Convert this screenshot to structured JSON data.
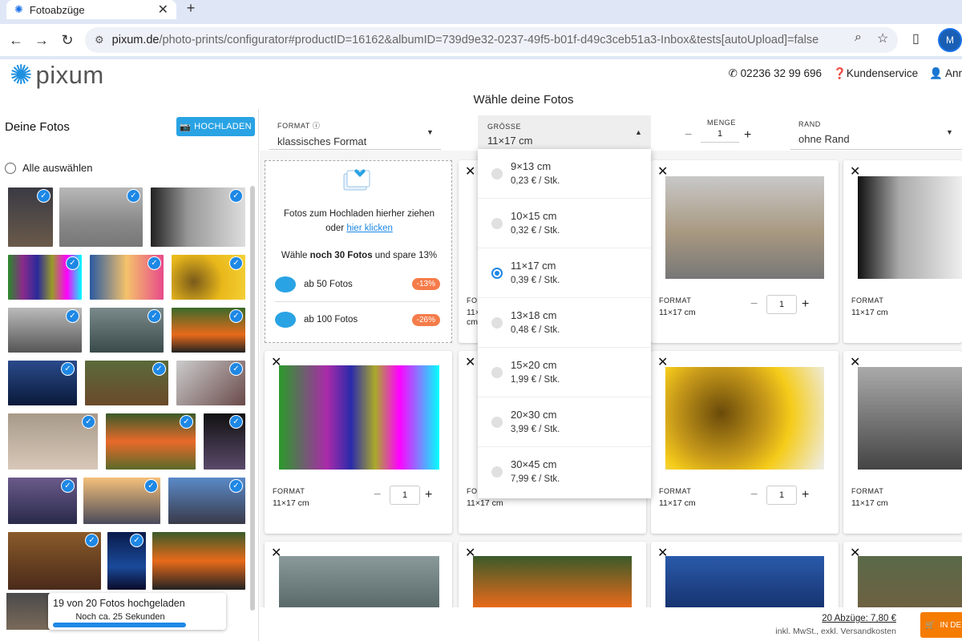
{
  "browser": {
    "tab_title": "Fotoabzüge",
    "tab_close": "✕",
    "new_tab": "+",
    "url_domain": "pixum.de",
    "url_path": "/photo-prints/configurator#productID=16162&albumID=739d9e32-0237-49f5-b01f-d49c3ceb51a3-Inbox&tests[autoUpload]=false",
    "profile_initial": "M"
  },
  "header": {
    "logo": "pixum",
    "phone": "02236 32 99 696",
    "service": "Kundenservice",
    "account": "Anr"
  },
  "page": {
    "title": "Wähle deine Fotos"
  },
  "sidebar": {
    "title": "Deine Fotos",
    "upload_label": "HOCHLADEN",
    "select_all": "Alle auswählen",
    "toast_main": "19 von 20 Fotos hochgeladen",
    "toast_sub": "Noch ca. 25 Sekunden"
  },
  "controls": {
    "format_label": "FORMAT",
    "format_value": "klassisches Format",
    "size_label": "GRÖSSE",
    "size_value": "11×17 cm",
    "qty_label": "MENGE",
    "qty_value": "1",
    "minus": "−",
    "plus": "+",
    "border_label": "RAND",
    "border_value": "ohne Rand"
  },
  "dropzone": {
    "line1": "Fotos zum Hochladen hierher ziehen",
    "line2_pre": "oder ",
    "line2_link": "hier klicken",
    "promo_pre": "Wähle ",
    "promo_bold": "noch 30 Fotos",
    "promo_post": " und spare 13%",
    "discounts": [
      {
        "label": "ab 50 Fotos",
        "badge": "-13%"
      },
      {
        "label": "ab 100 Fotos",
        "badge": "-26%"
      }
    ]
  },
  "sizes": [
    {
      "name": "9×13 cm",
      "price": "0,23 € / Stk.",
      "selected": false
    },
    {
      "name": "10×15 cm",
      "price": "0,32 € / Stk.",
      "selected": false
    },
    {
      "name": "11×17 cm",
      "price": "0,39 € / Stk.",
      "selected": true
    },
    {
      "name": "13×18 cm",
      "price": "0,48 € / Stk.",
      "selected": false
    },
    {
      "name": "15×20 cm",
      "price": "1,99 € / Stk.",
      "selected": false
    },
    {
      "name": "20×30 cm",
      "price": "3,99 € / Stk.",
      "selected": false
    },
    {
      "name": "30×45 cm",
      "price": "7,99 € / Stk.",
      "selected": false
    }
  ],
  "card": {
    "format_label": "FORMAT",
    "size": "11×17 cm",
    "qty": "1",
    "close": "✕"
  },
  "footer": {
    "total": "20 Abzüge: 7,80 €",
    "tax": "inkl. MwSt., exkl. Versandkosten",
    "cart_label": "IN DE"
  }
}
